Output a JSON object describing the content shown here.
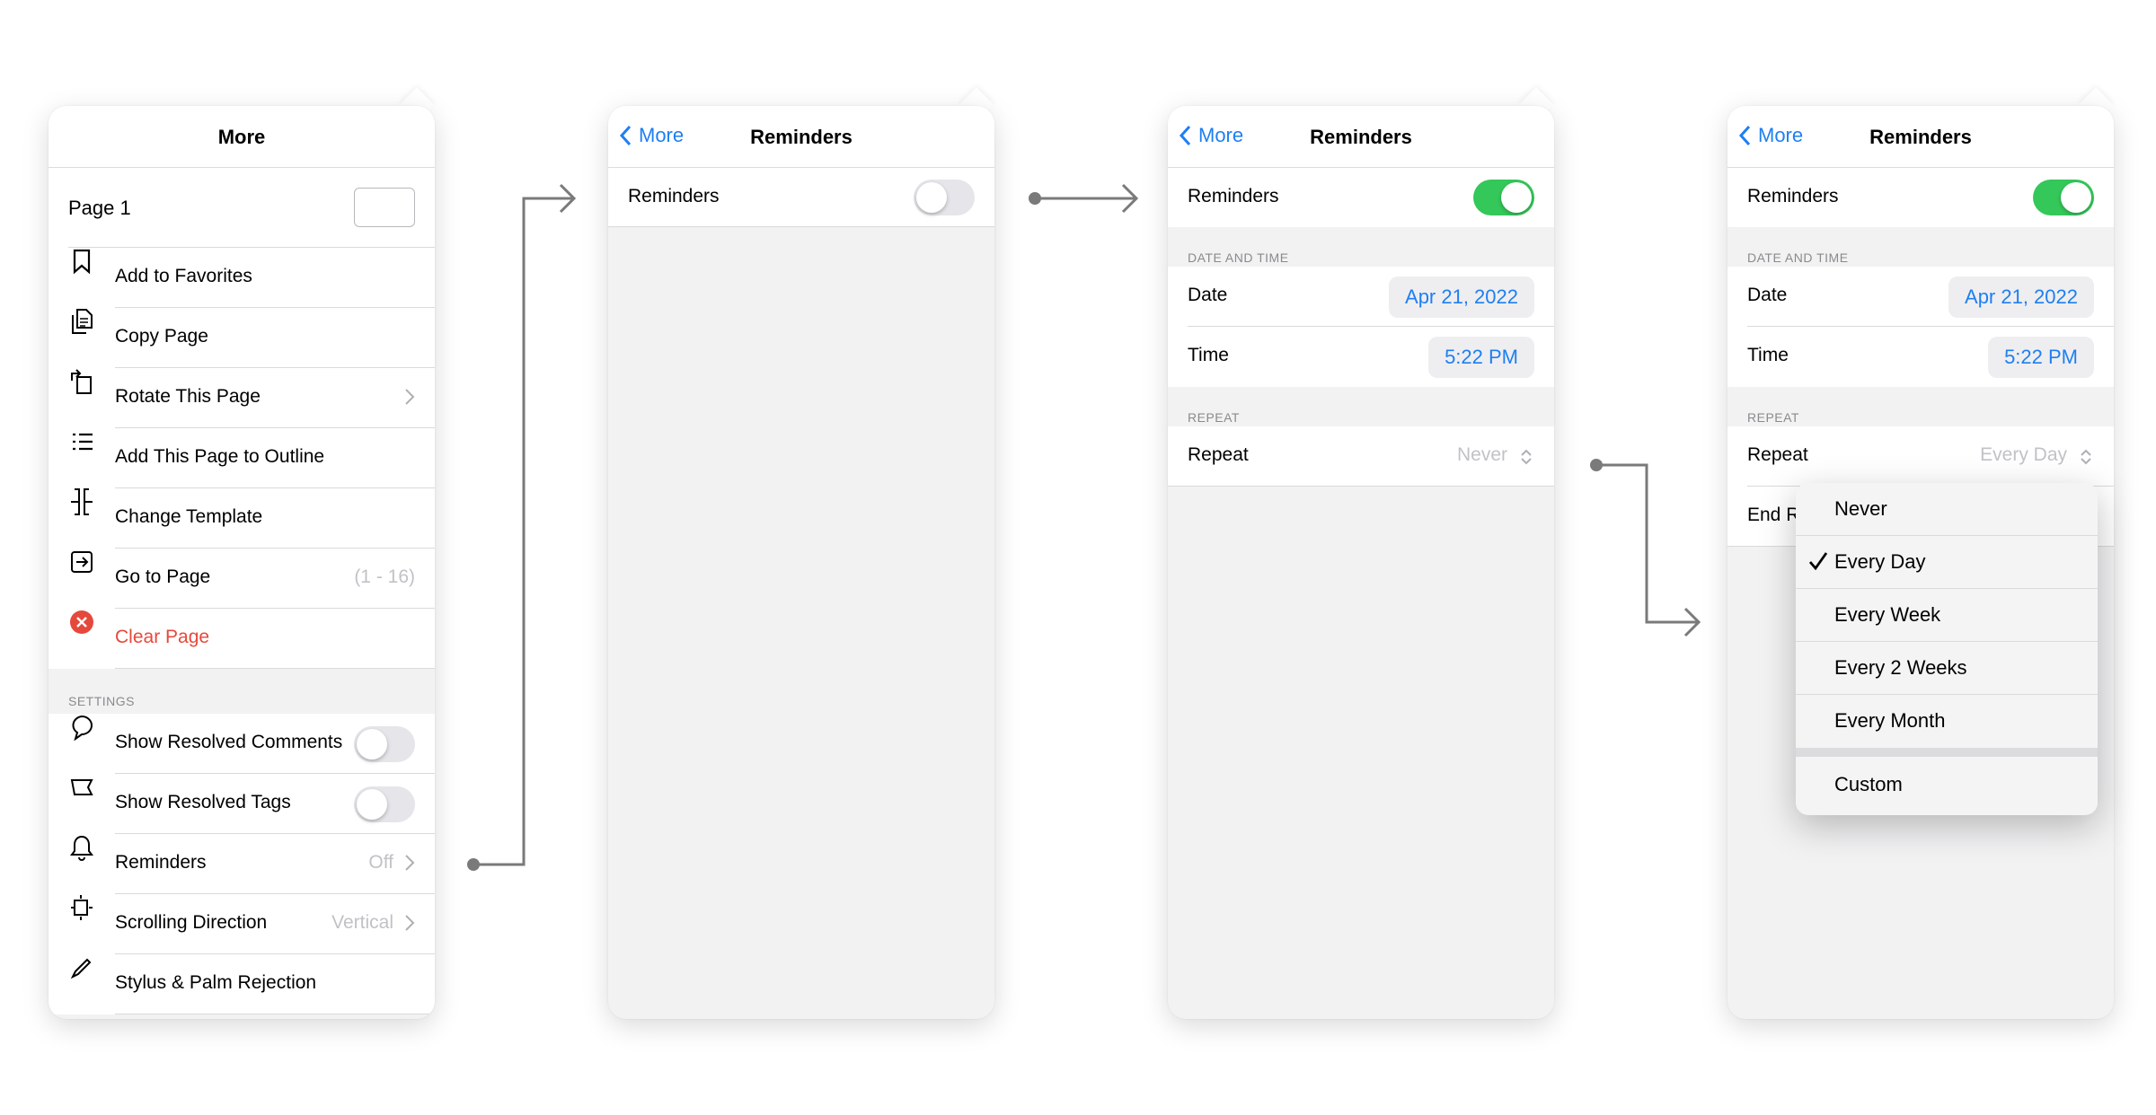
{
  "panel1": {
    "title": "More",
    "page_label": "Page 1",
    "menu_items": [
      {
        "label": "Add to Favorites",
        "icon": "bookmark-icon"
      },
      {
        "label": "Copy Page",
        "icon": "copy-page-icon"
      },
      {
        "label": "Rotate This Page",
        "icon": "rotate-icon"
      },
      {
        "label": "Add This Page to Outline",
        "icon": "outline-list-icon"
      },
      {
        "label": "Change Template",
        "icon": "template-icon"
      },
      {
        "label": "Go to Page",
        "icon": "go-to-page-icon",
        "value": "(1 - 16)"
      },
      {
        "label": "Clear Page",
        "icon": "clear-icon"
      }
    ],
    "settings_header": "SETTINGS",
    "settings_items": [
      {
        "label": "Show Resolved Comments",
        "icon": "comment-icon",
        "toggle": false
      },
      {
        "label": "Show Resolved Tags",
        "icon": "tag-icon",
        "toggle": false
      },
      {
        "label": "Reminders",
        "icon": "bell-icon",
        "value": "Off"
      },
      {
        "label": "Scrolling Direction",
        "icon": "scroll-direction-icon",
        "value": "Vertical"
      },
      {
        "label": "Stylus & Palm Rejection",
        "icon": "pencil-icon"
      }
    ]
  },
  "panel2": {
    "back_label": "More",
    "title": "Reminders",
    "reminders_label": "Reminders",
    "reminders_on": false
  },
  "panel3": {
    "back_label": "More",
    "title": "Reminders",
    "reminders_label": "Reminders",
    "reminders_on": true,
    "date_time_header": "DATE AND TIME",
    "date_label": "Date",
    "date_value": "Apr 21, 2022",
    "time_label": "Time",
    "time_value": "5:22 PM",
    "repeat_header": "REPEAT",
    "repeat_label": "Repeat",
    "repeat_value": "Never"
  },
  "panel4": {
    "back_label": "More",
    "title": "Reminders",
    "reminders_label": "Reminders",
    "reminders_on": true,
    "date_time_header": "DATE AND TIME",
    "date_label": "Date",
    "date_value": "Apr 21, 2022",
    "time_label": "Time",
    "time_value": "5:22 PM",
    "repeat_header": "REPEAT",
    "repeat_label": "Repeat",
    "repeat_value": "Every Day",
    "end_label_partial": "End R",
    "dropdown_options": [
      "Never",
      "Every Day",
      "Every Week",
      "Every 2 Weeks",
      "Every Month"
    ],
    "dropdown_selected": "Every Day",
    "dropdown_custom": "Custom"
  },
  "colors": {
    "accent": "#1e7ff2",
    "toggle_on": "#34c759",
    "destructive": "#e5493b",
    "connector": "#7a7a7a"
  }
}
